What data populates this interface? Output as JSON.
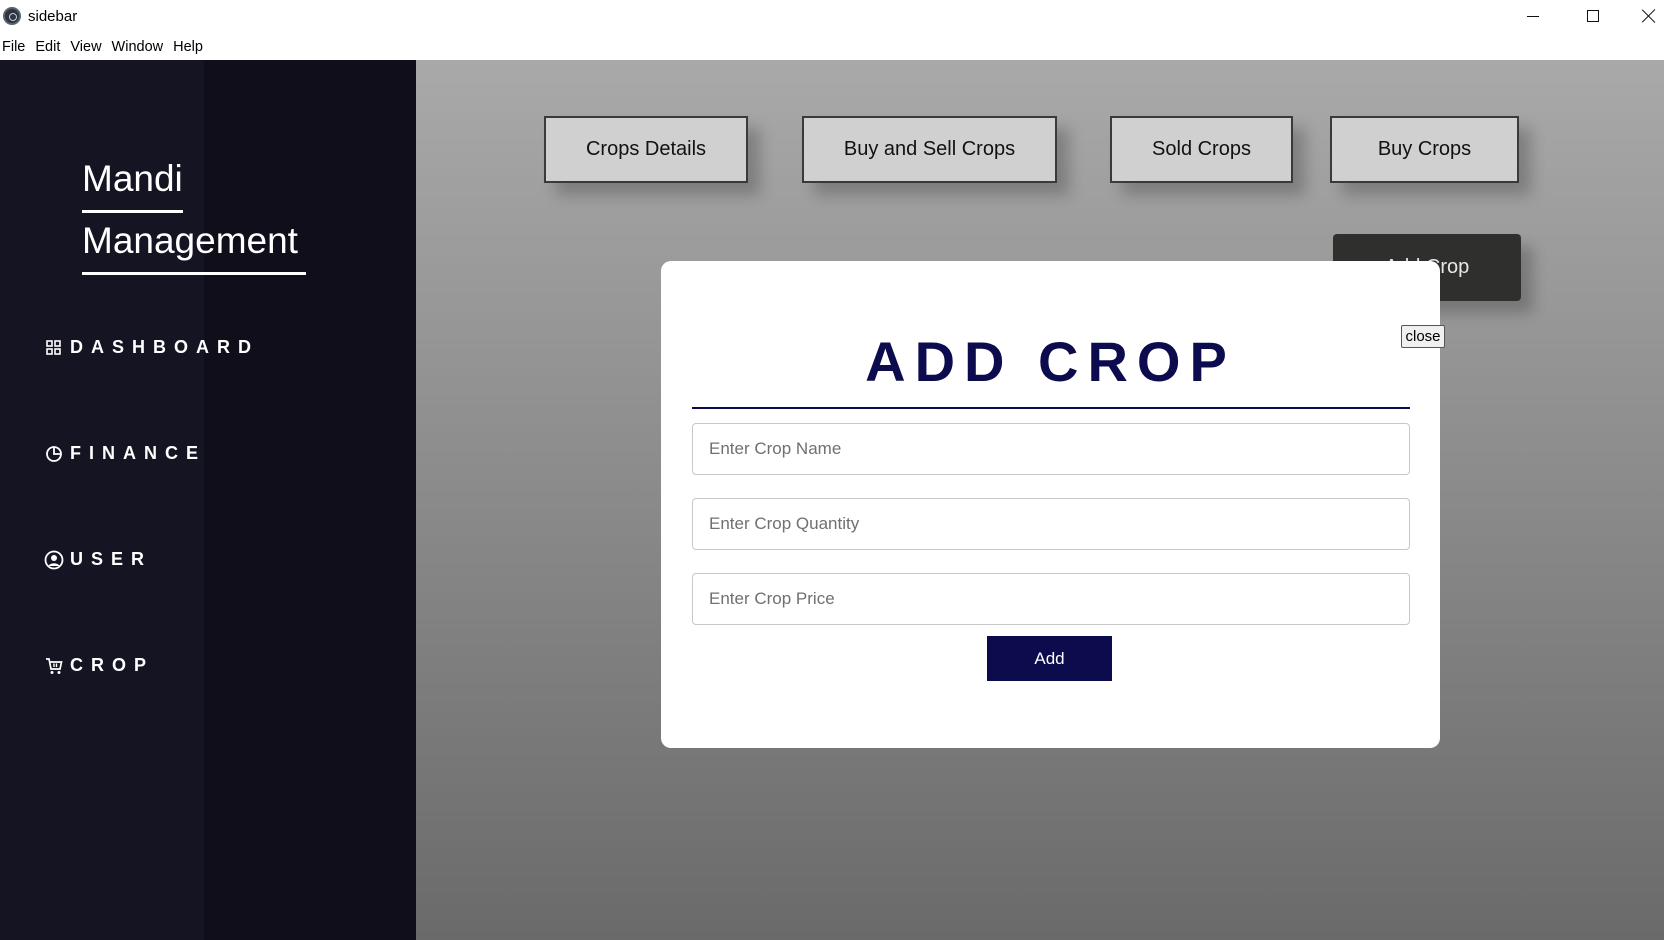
{
  "window": {
    "title": "sidebar"
  },
  "menu": [
    "File",
    "Edit",
    "View",
    "Window",
    "Help"
  ],
  "sidebar": {
    "brand_line1": "Mandi",
    "brand_line2": "Management",
    "items": [
      {
        "label": "DASHBOARD",
        "icon": "grid-icon"
      },
      {
        "label": "FINANCE",
        "icon": "pie-chart-icon"
      },
      {
        "label": "USER",
        "icon": "user-circle-icon"
      },
      {
        "label": "CROP",
        "icon": "cart-icon"
      }
    ]
  },
  "topnav": {
    "buttons": [
      "Crops Details",
      "Buy and Sell Crops",
      "Sold Crops",
      "Buy Crops"
    ],
    "add_crop": "Add Crop"
  },
  "modal": {
    "title": "ADD CROP",
    "close_label": "close",
    "fields": [
      {
        "placeholder": "Enter Crop Name",
        "value": ""
      },
      {
        "placeholder": "Enter Crop Quantity",
        "value": ""
      },
      {
        "placeholder": "Enter Crop Price",
        "value": ""
      }
    ],
    "submit_label": "Add"
  },
  "colors": {
    "sidebar_bg": "#141423",
    "modal_accent": "#0b0b4d",
    "nav_button_bg": "#d0d0d0",
    "add_crop_bg": "#2f302e"
  }
}
